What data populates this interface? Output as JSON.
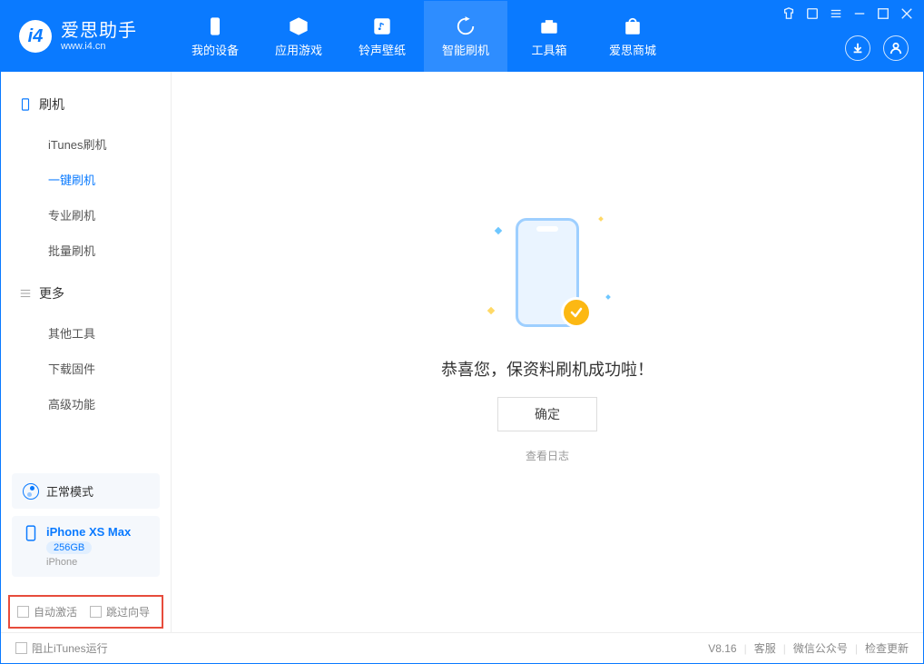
{
  "app": {
    "name": "爱思助手",
    "url": "www.i4.cn"
  },
  "nav": {
    "items": [
      {
        "label": "我的设备"
      },
      {
        "label": "应用游戏"
      },
      {
        "label": "铃声壁纸"
      },
      {
        "label": "智能刷机",
        "active": true
      },
      {
        "label": "工具箱"
      },
      {
        "label": "爱思商城"
      }
    ]
  },
  "sidebar": {
    "section1": {
      "title": "刷机",
      "items": [
        "iTunes刷机",
        "一键刷机",
        "专业刷机",
        "批量刷机"
      ],
      "activeIndex": 1
    },
    "section2": {
      "title": "更多",
      "items": [
        "其他工具",
        "下载固件",
        "高级功能"
      ]
    },
    "mode": {
      "label": "正常模式"
    },
    "device": {
      "name": "iPhone XS Max",
      "capacity": "256GB",
      "type": "iPhone"
    },
    "checkboxes": {
      "autoActivate": "自动激活",
      "skipGuide": "跳过向导"
    }
  },
  "main": {
    "successMessage": "恭喜您，保资料刷机成功啦！",
    "okButton": "确定",
    "viewLog": "查看日志"
  },
  "footer": {
    "blockItunes": "阻止iTunes运行",
    "version": "V8.16",
    "links": [
      "客服",
      "微信公众号",
      "检查更新"
    ]
  }
}
